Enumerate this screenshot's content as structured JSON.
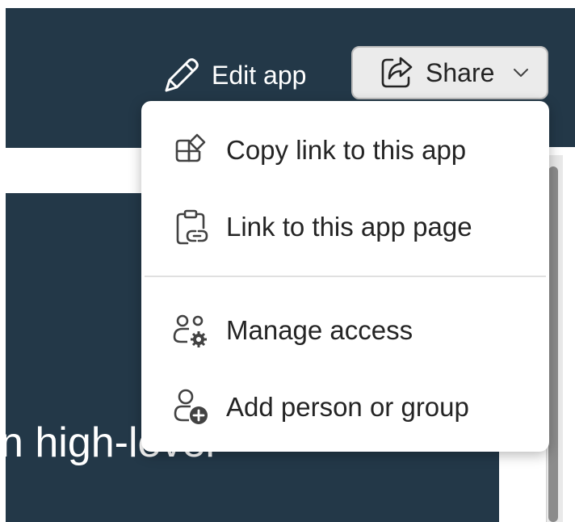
{
  "toolbar": {
    "edit_label": "Edit app",
    "share_label": "Share"
  },
  "background": {
    "partial_text": "n high-level"
  },
  "share_menu": {
    "items": [
      {
        "label": "Copy link to this app",
        "icon": "copy-link-icon"
      },
      {
        "label": "Link to this app page",
        "icon": "page-link-icon"
      },
      {
        "label": "Manage access",
        "icon": "manage-access-icon"
      },
      {
        "label": "Add person or group",
        "icon": "add-person-icon"
      }
    ]
  },
  "colors": {
    "header_bg": "#233848",
    "menu_bg": "#ffffff",
    "text": "#242424",
    "button_bg": "#ebebeb"
  }
}
